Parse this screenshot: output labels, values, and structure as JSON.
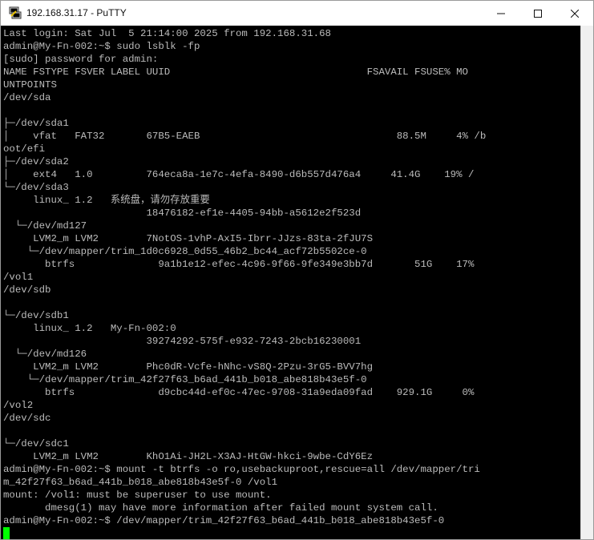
{
  "window": {
    "title": "192.168.31.17 - PuTTY",
    "app_icon": "putty-icon",
    "controls": [
      "minimize-icon",
      "maximize-icon",
      "close-icon"
    ]
  },
  "terminal": {
    "lines": [
      "Last login: Sat Jul  5 21:14:00 2025 from 192.168.31.68",
      "admin@My-Fn-002:~$ sudo lsblk -fp",
      "[sudo] password for admin:",
      "NAME FSTYPE FSVER LABEL UUID                                 FSAVAIL FSUSE% MO",
      "UNTPOINTS",
      "/dev/sda",
      "",
      "├─/dev/sda1",
      "│    vfat   FAT32       67B5-EAEB                                 88.5M     4% /b",
      "oot/efi",
      "├─/dev/sda2",
      "│    ext4   1.0         764eca8a-1e7c-4efa-8490-d6b557d476a4     41.4G    19% /",
      "└─/dev/sda3",
      "     linux_ 1.2   系统盘，请勿存放重要",
      "                        18476182-ef1e-4405-94bb-a5612e2f523d",
      "  └─/dev/md127",
      "     LVM2_m LVM2        7NotOS-1vhP-AxI5-Ibrr-JJzs-83ta-2fJU7S",
      "    └─/dev/mapper/trim_1d0c6928_0d55_46b2_bc44_acf72b5502ce-0",
      "       btrfs              9a1b1e12-efec-4c96-9f66-9fe349e3bb7d       51G    17%",
      "/vol1",
      "/dev/sdb",
      "",
      "└─/dev/sdb1",
      "     linux_ 1.2   My-Fn-002:0",
      "                        39274292-575f-e932-7243-2bcb16230001",
      "  └─/dev/md126",
      "     LVM2_m LVM2        Phc0dR-Vcfe-hNhc-vS8Q-2Pzu-3rG5-BVV7hg",
      "    └─/dev/mapper/trim_42f27f63_b6ad_441b_b018_abe818b43e5f-0",
      "       btrfs              d9cbc44d-ef0c-47ec-9708-31a9eda09fad    929.1G     0%",
      "/vol2",
      "/dev/sdc",
      "",
      "└─/dev/sdc1",
      "     LVM2_m LVM2        KhO1Ai-JH2L-X3AJ-HtGW-hkci-9wbe-CdY6Ez",
      "admin@My-Fn-002:~$ mount -t btrfs -o ro,usebackuproot,rescue=all /dev/mapper/tri",
      "m_42f27f63_b6ad_441b_b018_abe818b43e5f-0 /vol1",
      "mount: /vol1: must be superuser to use mount.",
      "       dmesg(1) may have more information after failed mount system call.",
      "admin@My-Fn-002:~$ /dev/mapper/trim_42f27f63_b6ad_441b_b018_abe818b43e5f-0"
    ]
  },
  "colors": {
    "terminal_bg": "#000000",
    "terminal_fg": "#bbbbbb",
    "cursor": "#00ff00"
  }
}
